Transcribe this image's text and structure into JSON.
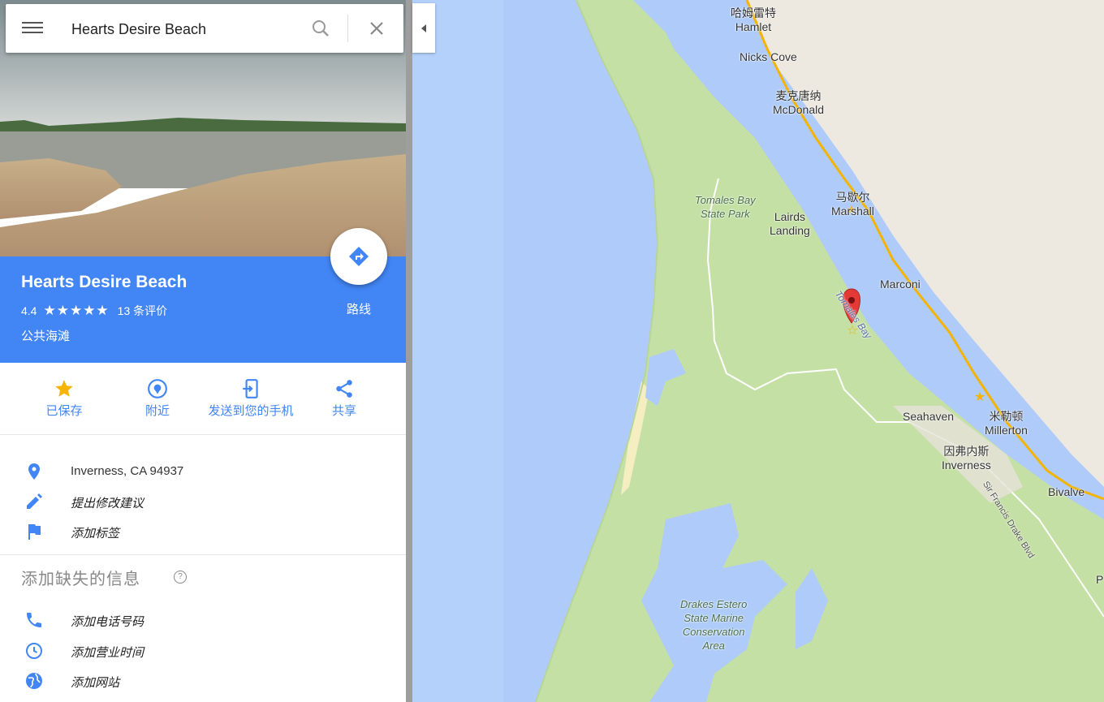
{
  "search": {
    "value": "Hearts Desire Beach"
  },
  "place": {
    "title": "Hearts Desire Beach",
    "rating": "4.4",
    "stars": "★★★★★",
    "reviews": "13 条评价",
    "category": "公共海滩",
    "directions_label": "路线"
  },
  "actions": [
    {
      "label": "已保存",
      "icon": "star-icon"
    },
    {
      "label": "附近",
      "icon": "nearby-icon"
    },
    {
      "label": "发送到您的手机",
      "icon": "send-to-phone-icon"
    },
    {
      "label": "共享",
      "icon": "share-icon"
    }
  ],
  "info": {
    "address": "Inverness, CA 94937",
    "suggest_edit": "提出修改建议",
    "add_label": "添加标签",
    "missing_title": "添加缺失的信息",
    "add_phone": "添加电话号码",
    "add_hours": "添加营业时间",
    "add_website": "添加网站"
  },
  "map_labels": {
    "hamlet_cn": "哈姆雷特",
    "hamlet": "Hamlet",
    "nicks_cove": "Nicks Cove",
    "mcdonald_cn": "麦克唐纳",
    "mcdonald": "McDonald",
    "tomales_park_1": "Tomales Bay",
    "tomales_park_2": "State Park",
    "lairds_1": "Lairds",
    "lairds_2": "Landing",
    "marshall_cn": "马歇尔",
    "marshall": "Marshall",
    "marconi": "Marconi",
    "tomales_bay": "Tomales Bay",
    "seahaven": "Seahaven",
    "millerton_cn": "米勒顿",
    "millerton": "Millerton",
    "inverness_cn": "因弗内斯",
    "inverness": "Inverness",
    "bivalve": "Bivalve",
    "sfd_blvd": "Sir Francis Drake Blvd",
    "drakes_1": "Drakes Estero",
    "drakes_2": "State Marine",
    "drakes_3": "Conservation",
    "drakes_4": "Area",
    "p_edge": "P"
  },
  "colors": {
    "accent": "#4285f4",
    "water": "#a8c8f8",
    "land": "#c8e0a0",
    "pin": "#e53935"
  }
}
